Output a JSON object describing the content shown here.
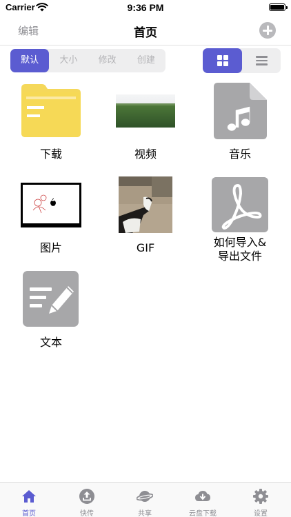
{
  "status_bar": {
    "carrier": "Carrier",
    "time": "9:36 PM"
  },
  "nav": {
    "edit_label": "编辑",
    "title": "首页"
  },
  "sort_options": [
    "默认",
    "大小",
    "修改",
    "创建"
  ],
  "grid_items": [
    {
      "label": "下载",
      "icon": "folder-icon"
    },
    {
      "label": "视频",
      "icon": "video-thumbnail"
    },
    {
      "label": "音乐",
      "icon": "music-file-icon"
    },
    {
      "label": "图片",
      "icon": "image-thumbnail"
    },
    {
      "label": "GIF",
      "icon": "gif-thumbnail"
    },
    {
      "label_line1": "如何导入&",
      "label_line2": "导出文件",
      "icon": "pdf-icon"
    },
    {
      "label": "文本",
      "icon": "text-note-icon"
    }
  ],
  "tabs": [
    {
      "label": "首页",
      "icon": "home-icon"
    },
    {
      "label": "快传",
      "icon": "upload-icon"
    },
    {
      "label": "共享",
      "icon": "planet-icon"
    },
    {
      "label": "云盘下载",
      "icon": "cloud-download-icon"
    },
    {
      "label": "设置",
      "icon": "gear-icon"
    }
  ],
  "colors": {
    "accent": "#5b5cd1",
    "folder": "#f5d85a",
    "icon_gray": "#a7a7a9"
  }
}
